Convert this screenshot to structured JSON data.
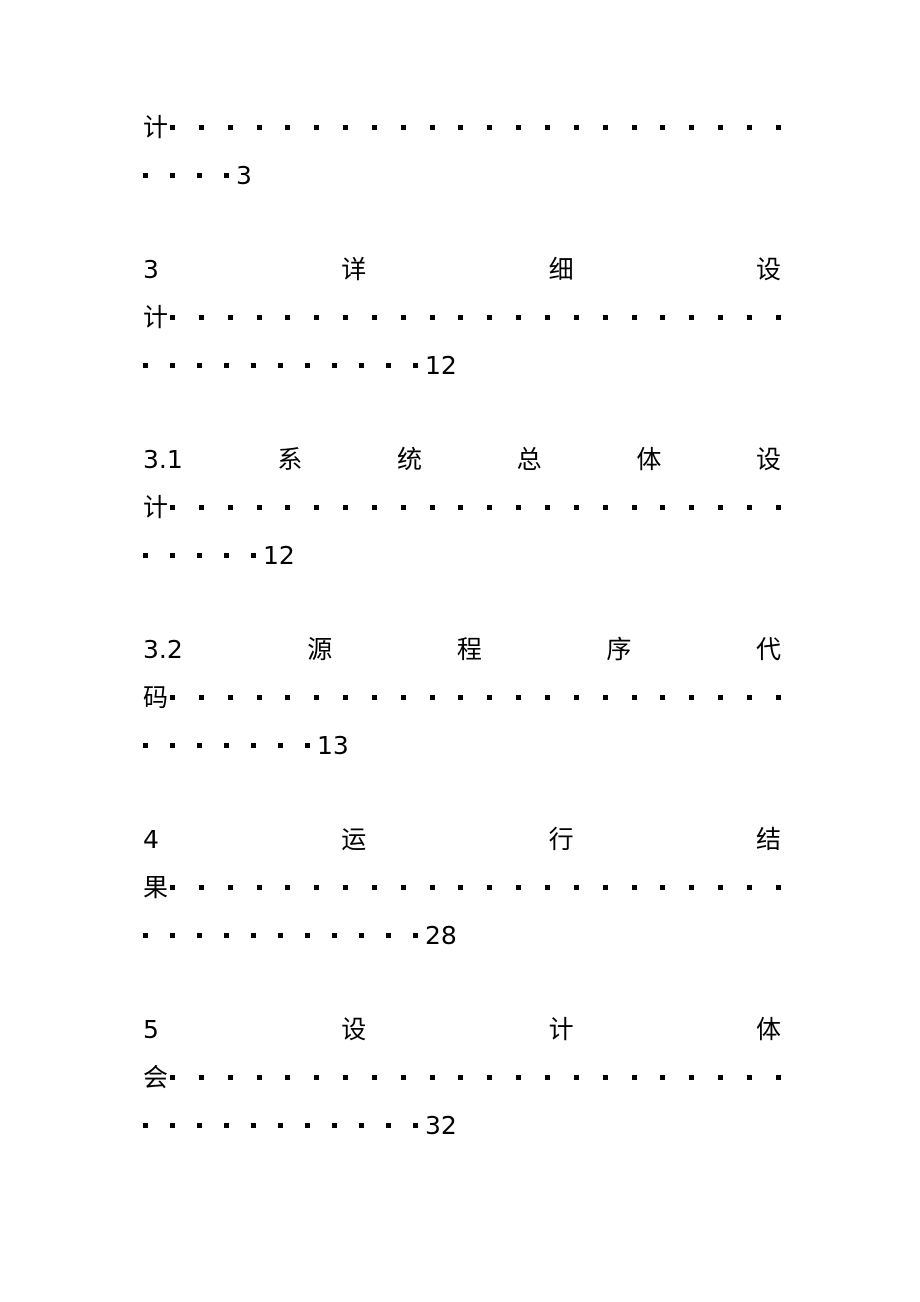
{
  "document": {
    "type": "table-of-contents",
    "page_background": "#ffffff",
    "text_color": "#000000",
    "leader_style": "square-dot"
  },
  "toc": {
    "entries": [
      {
        "id": "entry-continuation",
        "number": "",
        "title_chars": [],
        "continuation_char": "计",
        "leader_dots_line2": 22,
        "leader_dots_line3": 4,
        "page": "3",
        "is_continuation": true
      },
      {
        "id": "entry-3",
        "number": "3",
        "title_chars": [
          "详",
          "细",
          "设"
        ],
        "continuation_char": "计",
        "leader_dots_line2": 22,
        "leader_dots_line3": 11,
        "page": "12",
        "is_continuation": false
      },
      {
        "id": "entry-3-1",
        "number": "3.1",
        "title_chars": [
          "系",
          "统",
          "总",
          "体",
          "设"
        ],
        "continuation_char": "计",
        "leader_dots_line2": 22,
        "leader_dots_line3": 5,
        "page": "12",
        "is_continuation": false
      },
      {
        "id": "entry-3-2",
        "number": "3.2",
        "title_chars": [
          "源",
          "程",
          "序",
          "代"
        ],
        "continuation_char": "码",
        "leader_dots_line2": 22,
        "leader_dots_line3": 7,
        "page": "13",
        "is_continuation": false
      },
      {
        "id": "entry-4",
        "number": "4",
        "title_chars": [
          "运",
          "行",
          "结"
        ],
        "continuation_char": "果",
        "leader_dots_line2": 22,
        "leader_dots_line3": 11,
        "page": "28",
        "is_continuation": false
      },
      {
        "id": "entry-5",
        "number": "5",
        "title_chars": [
          "设",
          "计",
          "体"
        ],
        "continuation_char": "会",
        "leader_dots_line2": 22,
        "leader_dots_line3": 11,
        "page": "32",
        "is_continuation": false
      }
    ]
  }
}
